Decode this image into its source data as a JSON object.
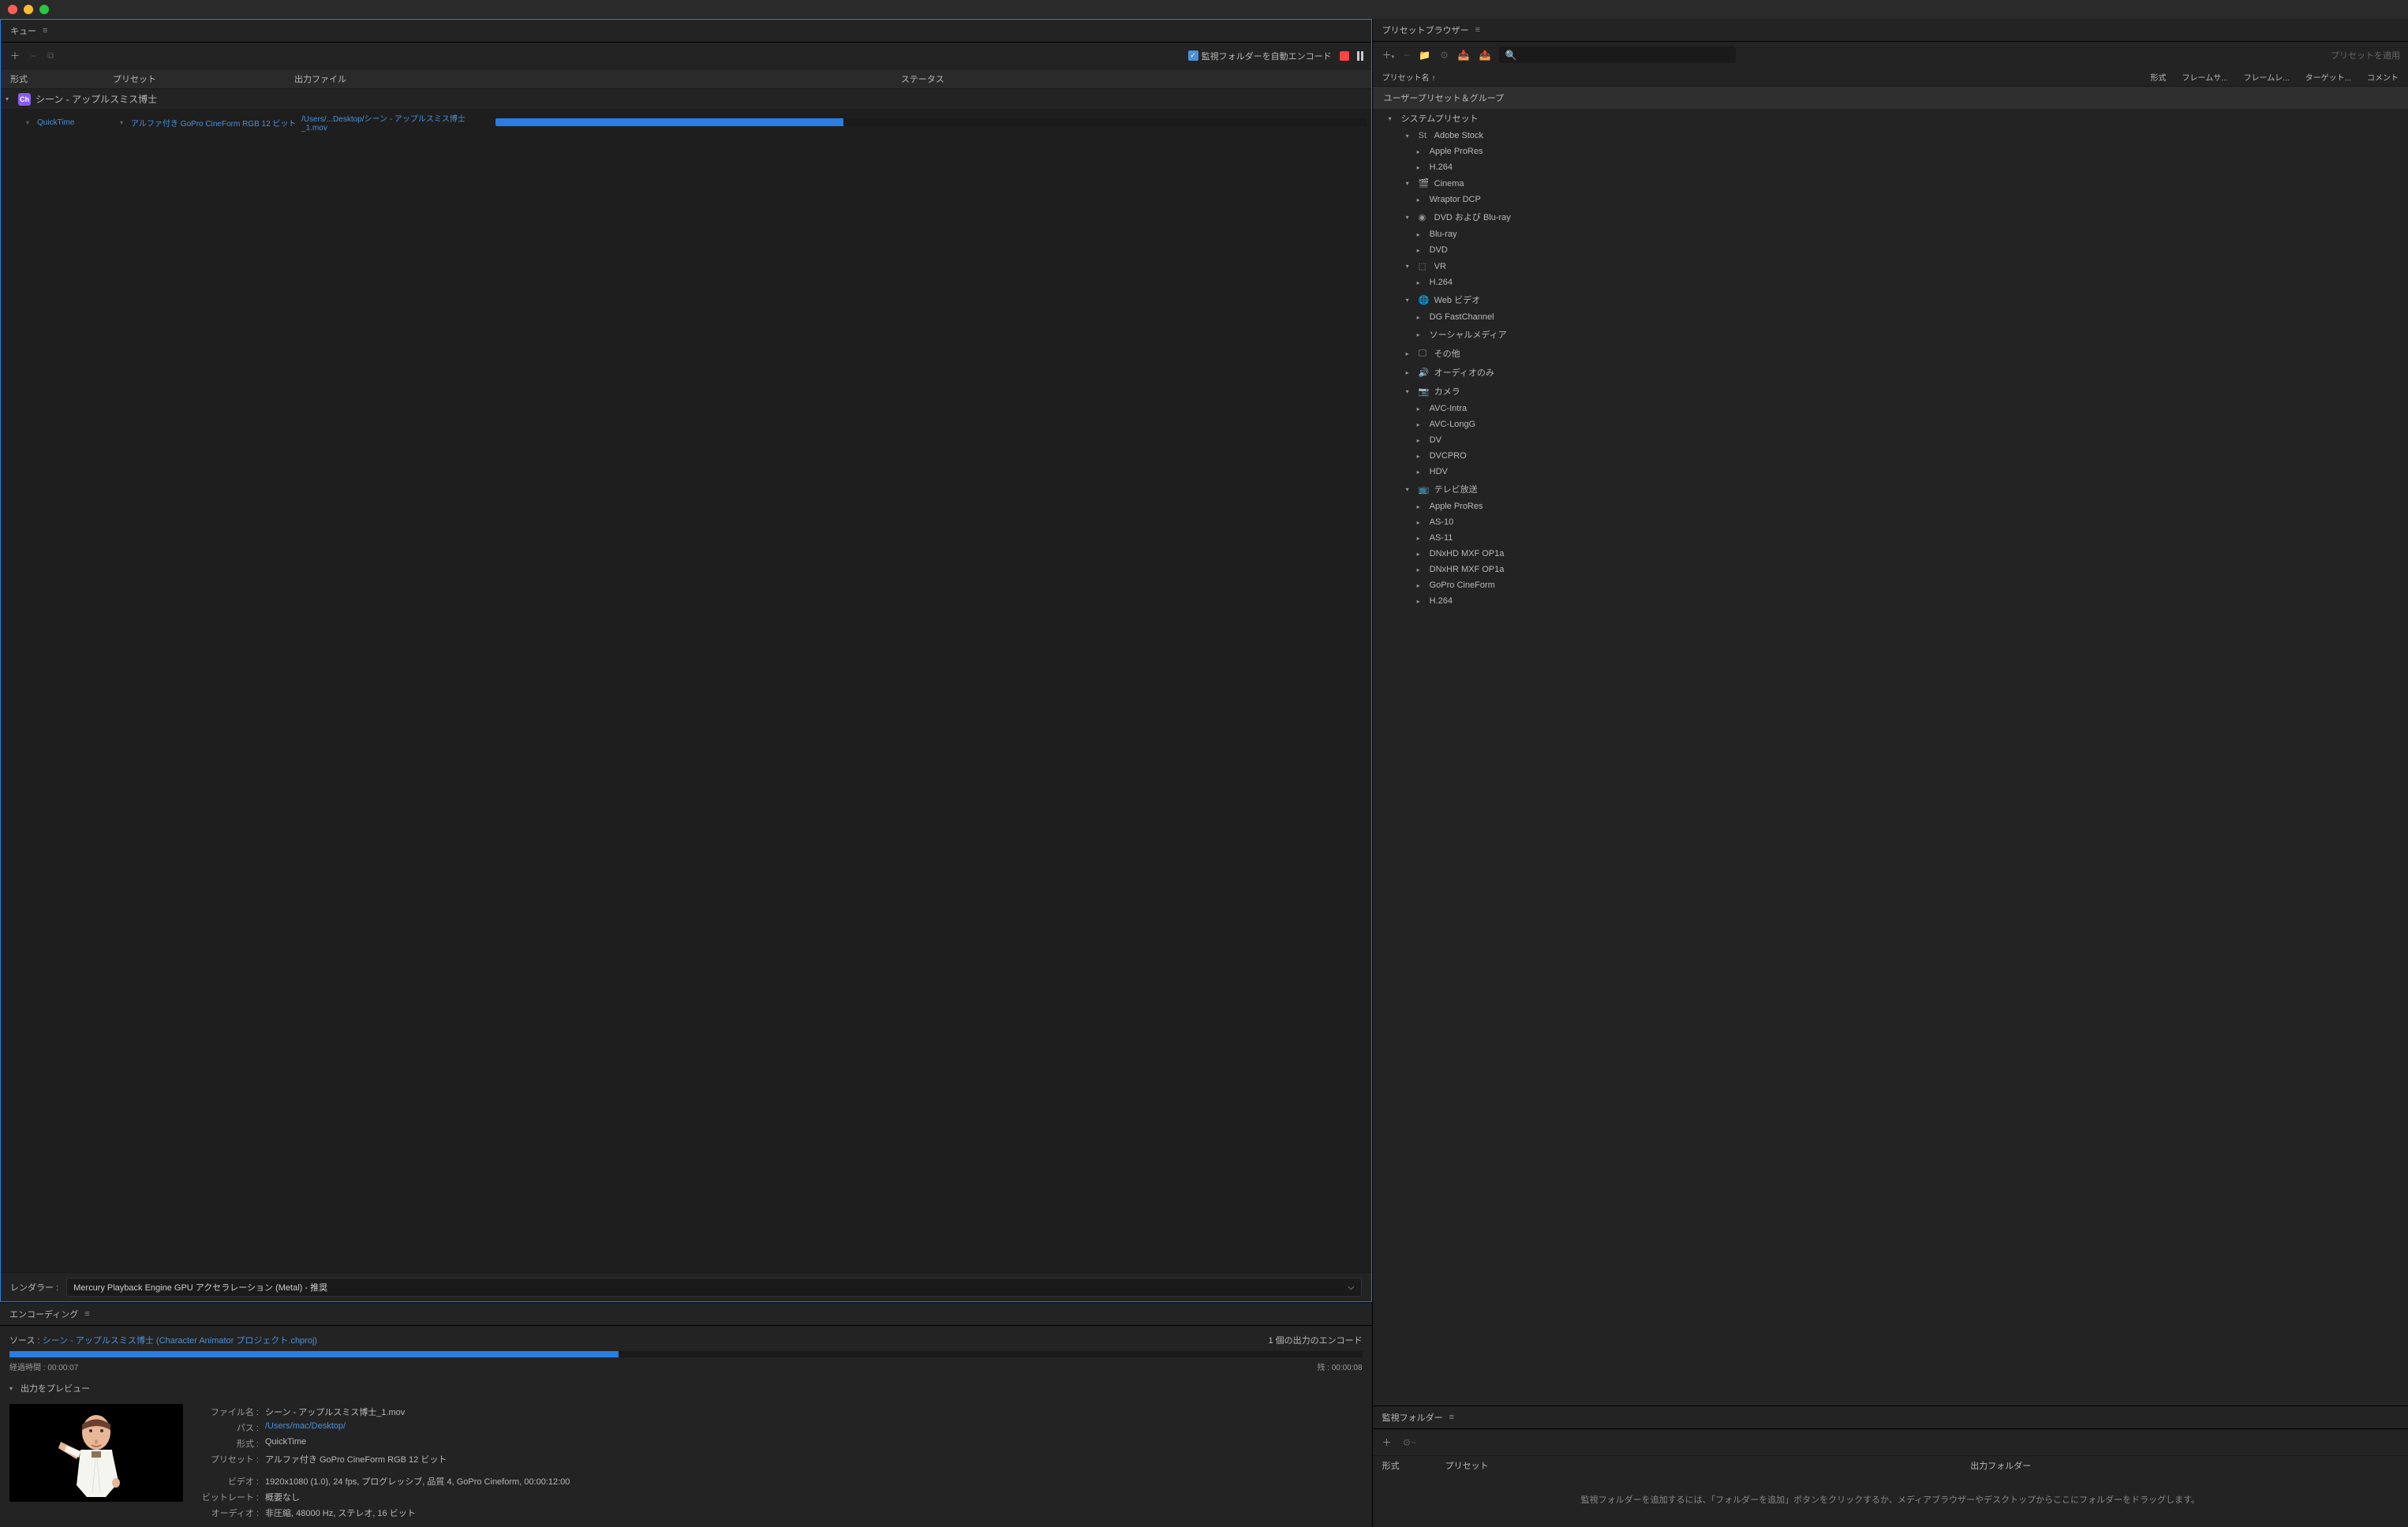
{
  "queue": {
    "title": "キュー",
    "add_icon": "＋",
    "auto_encode_label": "監視フォルダーを自動エンコード",
    "columns": {
      "format": "形式",
      "preset": "プリセット",
      "output": "出力ファイル",
      "status": "ステータス"
    },
    "item_name": "シーン - アップルスミス博士",
    "row": {
      "format": "QuickTime",
      "preset": "アルファ付き GoPro CineForm RGB 12 ビット",
      "output": "/Users/...Desktop/シーン - アップルスミス博士_1.mov",
      "progress_pct": 40
    },
    "renderer_label": "レンダラー :",
    "renderer_value": "Mercury Playback Engine GPU アクセラレーション (Metal) - 推奨"
  },
  "encoding": {
    "title": "エンコーディング",
    "source_label": "ソース : ",
    "source_name": "シーン - アップルスミス博士 (Character Animator プロジェクト.chproj)",
    "output_count": "1 個の出力のエンコード",
    "progress_pct": 45,
    "elapsed_label": "経過時間 : ",
    "elapsed_value": "00:00:07",
    "remaining_label": "残 : ",
    "remaining_value": "00:00:08",
    "preview_header": "出力をプレビュー",
    "details": {
      "filename_label": "ファイル名 :",
      "filename_value": "シーン - アップルスミス博士_1.mov",
      "path_label": "パス :",
      "path_value": "/Users/mac/Desktop/",
      "format_label": "形式 :",
      "format_value": "QuickTime",
      "preset_label": "プリセット :",
      "preset_value": "アルファ付き GoPro CineForm RGB 12 ビット",
      "video_label": "ビデオ :",
      "video_value": "1920x1080 (1.0), 24 fps, プログレッシブ, 品質 4, GoPro Cineform, 00:00:12:00",
      "bitrate_label": "ビットレート :",
      "bitrate_value": "概要なし",
      "audio_label": "オーディオ :",
      "audio_value": "非圧縮, 48000 Hz, ステレオ, 16 ビット"
    }
  },
  "preset_browser": {
    "title": "プリセットブラウザー",
    "apply_label": "プリセットを適用",
    "search_placeholder": "",
    "name_col": "プリセット名 ↑",
    "cols": [
      "形式",
      "フレームサ...",
      "フレームレ...",
      "ターゲット...",
      "コメント"
    ],
    "user_group": "ユーザープリセット＆グループ",
    "system_group": "システムプリセット",
    "tree": [
      {
        "label": "Adobe Stock",
        "icon": "St",
        "expanded": true,
        "children": [
          "Apple ProRes",
          "H.264"
        ]
      },
      {
        "label": "Cinema",
        "icon": "🎬",
        "expanded": true,
        "children": [
          "Wraptor DCP"
        ]
      },
      {
        "label": "DVD および Blu-ray",
        "icon": "💿",
        "expanded": true,
        "children": [
          "Blu-ray",
          "DVD"
        ]
      },
      {
        "label": "VR",
        "icon": "vr",
        "expanded": true,
        "children": [
          "H.264"
        ]
      },
      {
        "label": "Web ビデオ",
        "icon": "🌐",
        "expanded": true,
        "children": [
          "DG FastChannel",
          "ソーシャルメディア"
        ]
      },
      {
        "label": "その他",
        "icon": "🖥",
        "expanded": false,
        "children": []
      },
      {
        "label": "オーディオのみ",
        "icon": "🔊",
        "expanded": false,
        "children": []
      },
      {
        "label": "カメラ",
        "icon": "📷",
        "expanded": true,
        "children": [
          "AVC-Intra",
          "AVC-LongG",
          "DV",
          "DVCPRO",
          "HDV"
        ]
      },
      {
        "label": "テレビ放送",
        "icon": "📺",
        "expanded": true,
        "children": [
          "Apple ProRes",
          "AS-10",
          "AS-11",
          "DNxHD MXF OP1a",
          "DNxHR MXF OP1a",
          "GoPro CineForm",
          "H.264"
        ]
      }
    ]
  },
  "watch": {
    "title": "監視フォルダー",
    "columns": {
      "format": "形式",
      "preset": "プリセット",
      "output": "出力フォルダー"
    },
    "empty_text": "監視フォルダーを追加するには、「フォルダーを追加」ボタンをクリックするか、メディアブラウザーやデスクトップからここにフォルダーをドラッグします。"
  }
}
